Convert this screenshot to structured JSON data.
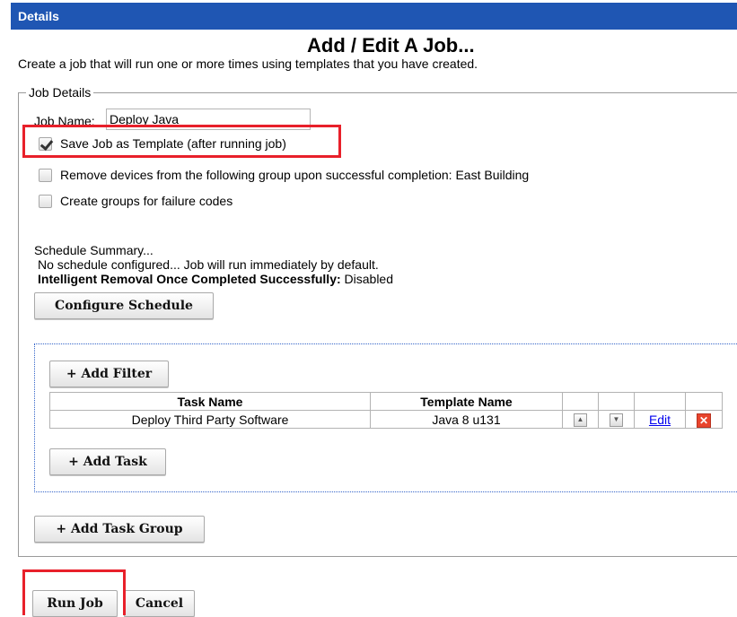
{
  "header": {
    "title": "Details"
  },
  "page": {
    "title": "Add / Edit A Job...",
    "description": "Create a job that will run one or more times using templates that you have created."
  },
  "job_details": {
    "legend": "Job Details",
    "job_name_label": "Job Name:",
    "job_name_value": "Deploy Java",
    "options": [
      {
        "label": "Save Job as Template (after running job)",
        "checked": true
      },
      {
        "label": "Remove devices from the following group upon successful completion: East Building",
        "checked": false
      },
      {
        "label": "Create groups for failure codes",
        "checked": false
      }
    ]
  },
  "schedule": {
    "title": "Schedule Summary...",
    "line1": "No schedule configured... Job will run immediately by default.",
    "removal_label": "Intelligent Removal Once Completed Successfully:",
    "removal_value": " Disabled",
    "configure_button": "Configure Schedule"
  },
  "tasks": {
    "add_filter_button": "+ Add Filter",
    "columns": [
      "Task Name",
      "Template Name"
    ],
    "rows": [
      {
        "task_name": "Deploy Third Party Software",
        "template_name": "Java 8 u131",
        "edit_label": "Edit"
      }
    ],
    "add_task_button": "+ Add Task"
  },
  "add_task_group_button": "+ Add Task Group",
  "footer": {
    "run_job_button": "Run Job",
    "cancel_button": "Cancel"
  },
  "colors": {
    "header_bg": "#1f56b3",
    "highlight": "#e8202a",
    "link": "#0000ee"
  },
  "icons": [
    "checkmark-icon",
    "up-arrow-icon",
    "down-arrow-icon",
    "delete-icon"
  ]
}
